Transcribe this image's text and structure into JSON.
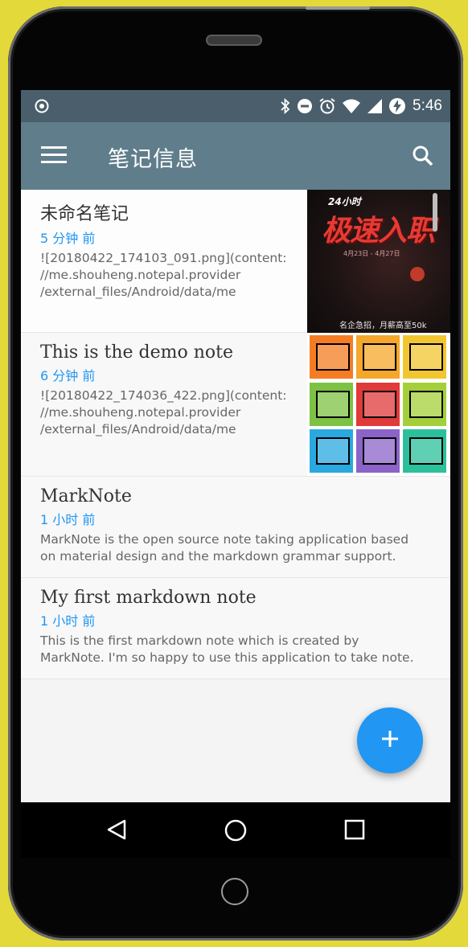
{
  "status_bar": {
    "time": "5:46",
    "icons": [
      "location-icon",
      "bluetooth-icon",
      "do-not-disturb-icon",
      "alarm-icon",
      "wifi-icon",
      "cellular-signal-icon",
      "battery-charging-icon"
    ]
  },
  "toolbar": {
    "title": "笔记信息",
    "menu_icon": "menu-icon",
    "search_icon": "search-icon"
  },
  "notes": [
    {
      "title": "未命名笔记",
      "time": "5 分钟 前",
      "snippet": "![20180422_174103_091.png](content:\n//me.shouheng.notepal.provider\n/external_files/Android/data/me",
      "thumbnail": {
        "type": "poster",
        "top_text": "24小时",
        "headline": "极速入职",
        "dates": "4月23日 - 4月27日",
        "footer": "名企急招，月薪高至50k"
      }
    },
    {
      "title": "This is the demo note",
      "time": "6 分钟 前",
      "snippet": "![20180422_174036_422.png](content:\n//me.shouheng.notepal.provider\n/external_files/Android/data/me",
      "thumbnail": {
        "type": "grid",
        "tile_colors": [
          "#f57c23",
          "#f4a72a",
          "#f2c62f",
          "#7dc242",
          "#e03a3a",
          "#a4cf3a",
          "#2aa8e0",
          "#8b63c9",
          "#2bbf9b"
        ]
      }
    },
    {
      "title": "MarkNote",
      "time": "1 小时 前",
      "snippet": "MarkNote is the open source note taking application based\non material design and the markdown grammar support."
    },
    {
      "title": "My first markdown note",
      "time": "1 小时 前",
      "snippet": "This is the first markdown note which is created by\nMarkNote. I'm so happy to use this application to take note."
    }
  ],
  "fab": {
    "icon": "plus-icon"
  },
  "nav_bar": {
    "icons": [
      "back-icon",
      "home-icon",
      "recents-icon"
    ]
  },
  "colors": {
    "status_bar": "#4a5f6b",
    "toolbar": "#607d8b",
    "accent": "#2196f3",
    "background": "#e3d93a"
  }
}
